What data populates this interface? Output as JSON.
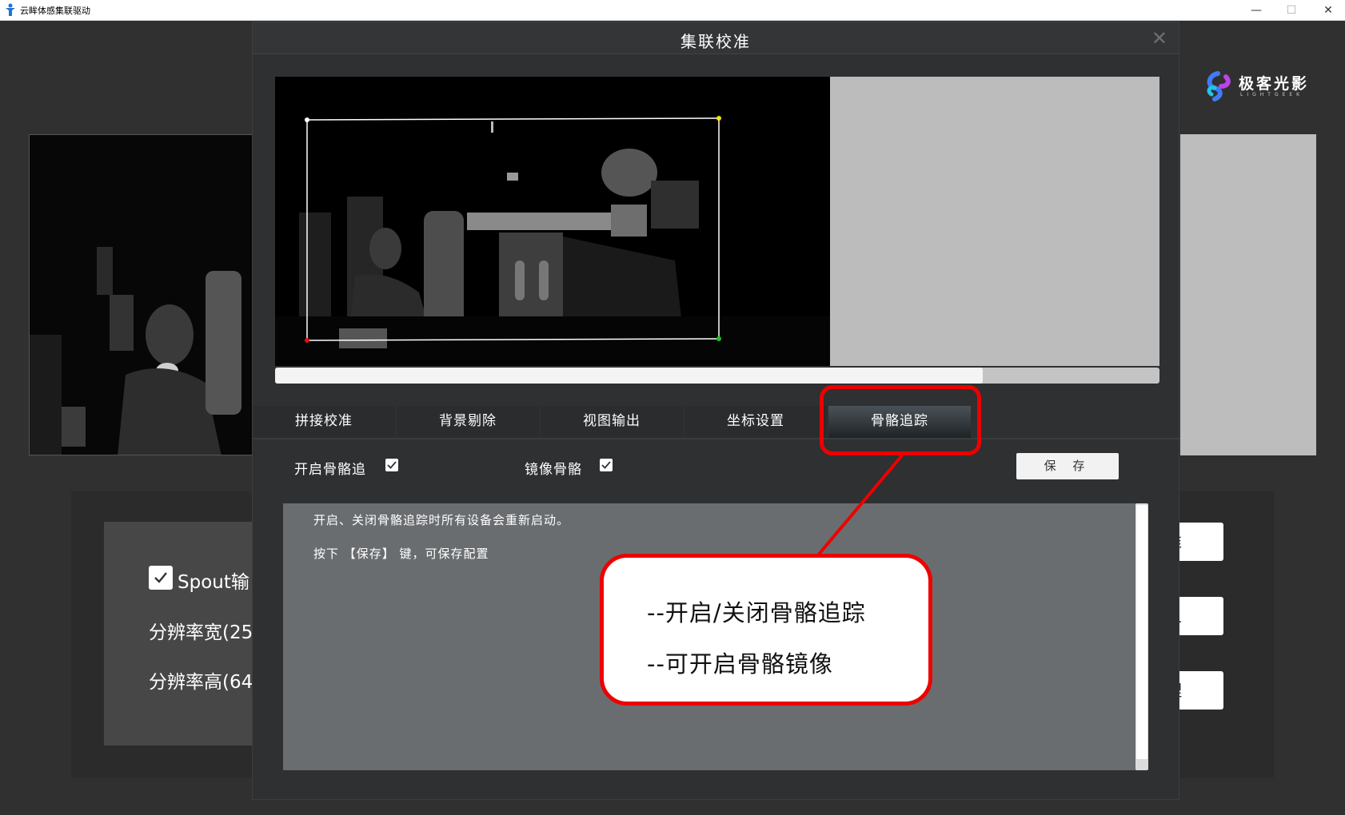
{
  "window": {
    "title": "云眸体感集联驱动",
    "minimize": "—",
    "maximize": "☐",
    "close": "✕",
    "icon": "app-figure-icon"
  },
  "background": {
    "logo_text": "极客光影",
    "logo_sub": "LIGHTGEEK",
    "spout_label": "Spout输",
    "res_width_label": "分辨率宽(25",
    "res_height_label": "分辨率高(64",
    "side_buttons": [
      "准",
      "人",
      "理"
    ]
  },
  "dialog": {
    "title": "集联校准",
    "close_glyph": "✕",
    "tabs": [
      "拼接校准",
      "背景剔除",
      "视图输出",
      "坐标设置",
      "骨骼追踪"
    ],
    "active_tab_index": 4,
    "options": {
      "enable_skeleton_label": "开启骨骼追",
      "enable_skeleton_checked": true,
      "mirror_skeleton_label": "镜像骨骼",
      "mirror_skeleton_checked": true
    },
    "save_label": "保 存",
    "info_lines": [
      "开启、关闭骨骼追踪时所有设备会重新启动。",
      "按下 【保存】 键，可保存配置"
    ],
    "h_scroll_fraction": 0.8
  },
  "annotation": {
    "lines": [
      "--开启/关闭骨骼追踪",
      "--可开启骨骼镜像"
    ],
    "color": "#ee0000"
  }
}
